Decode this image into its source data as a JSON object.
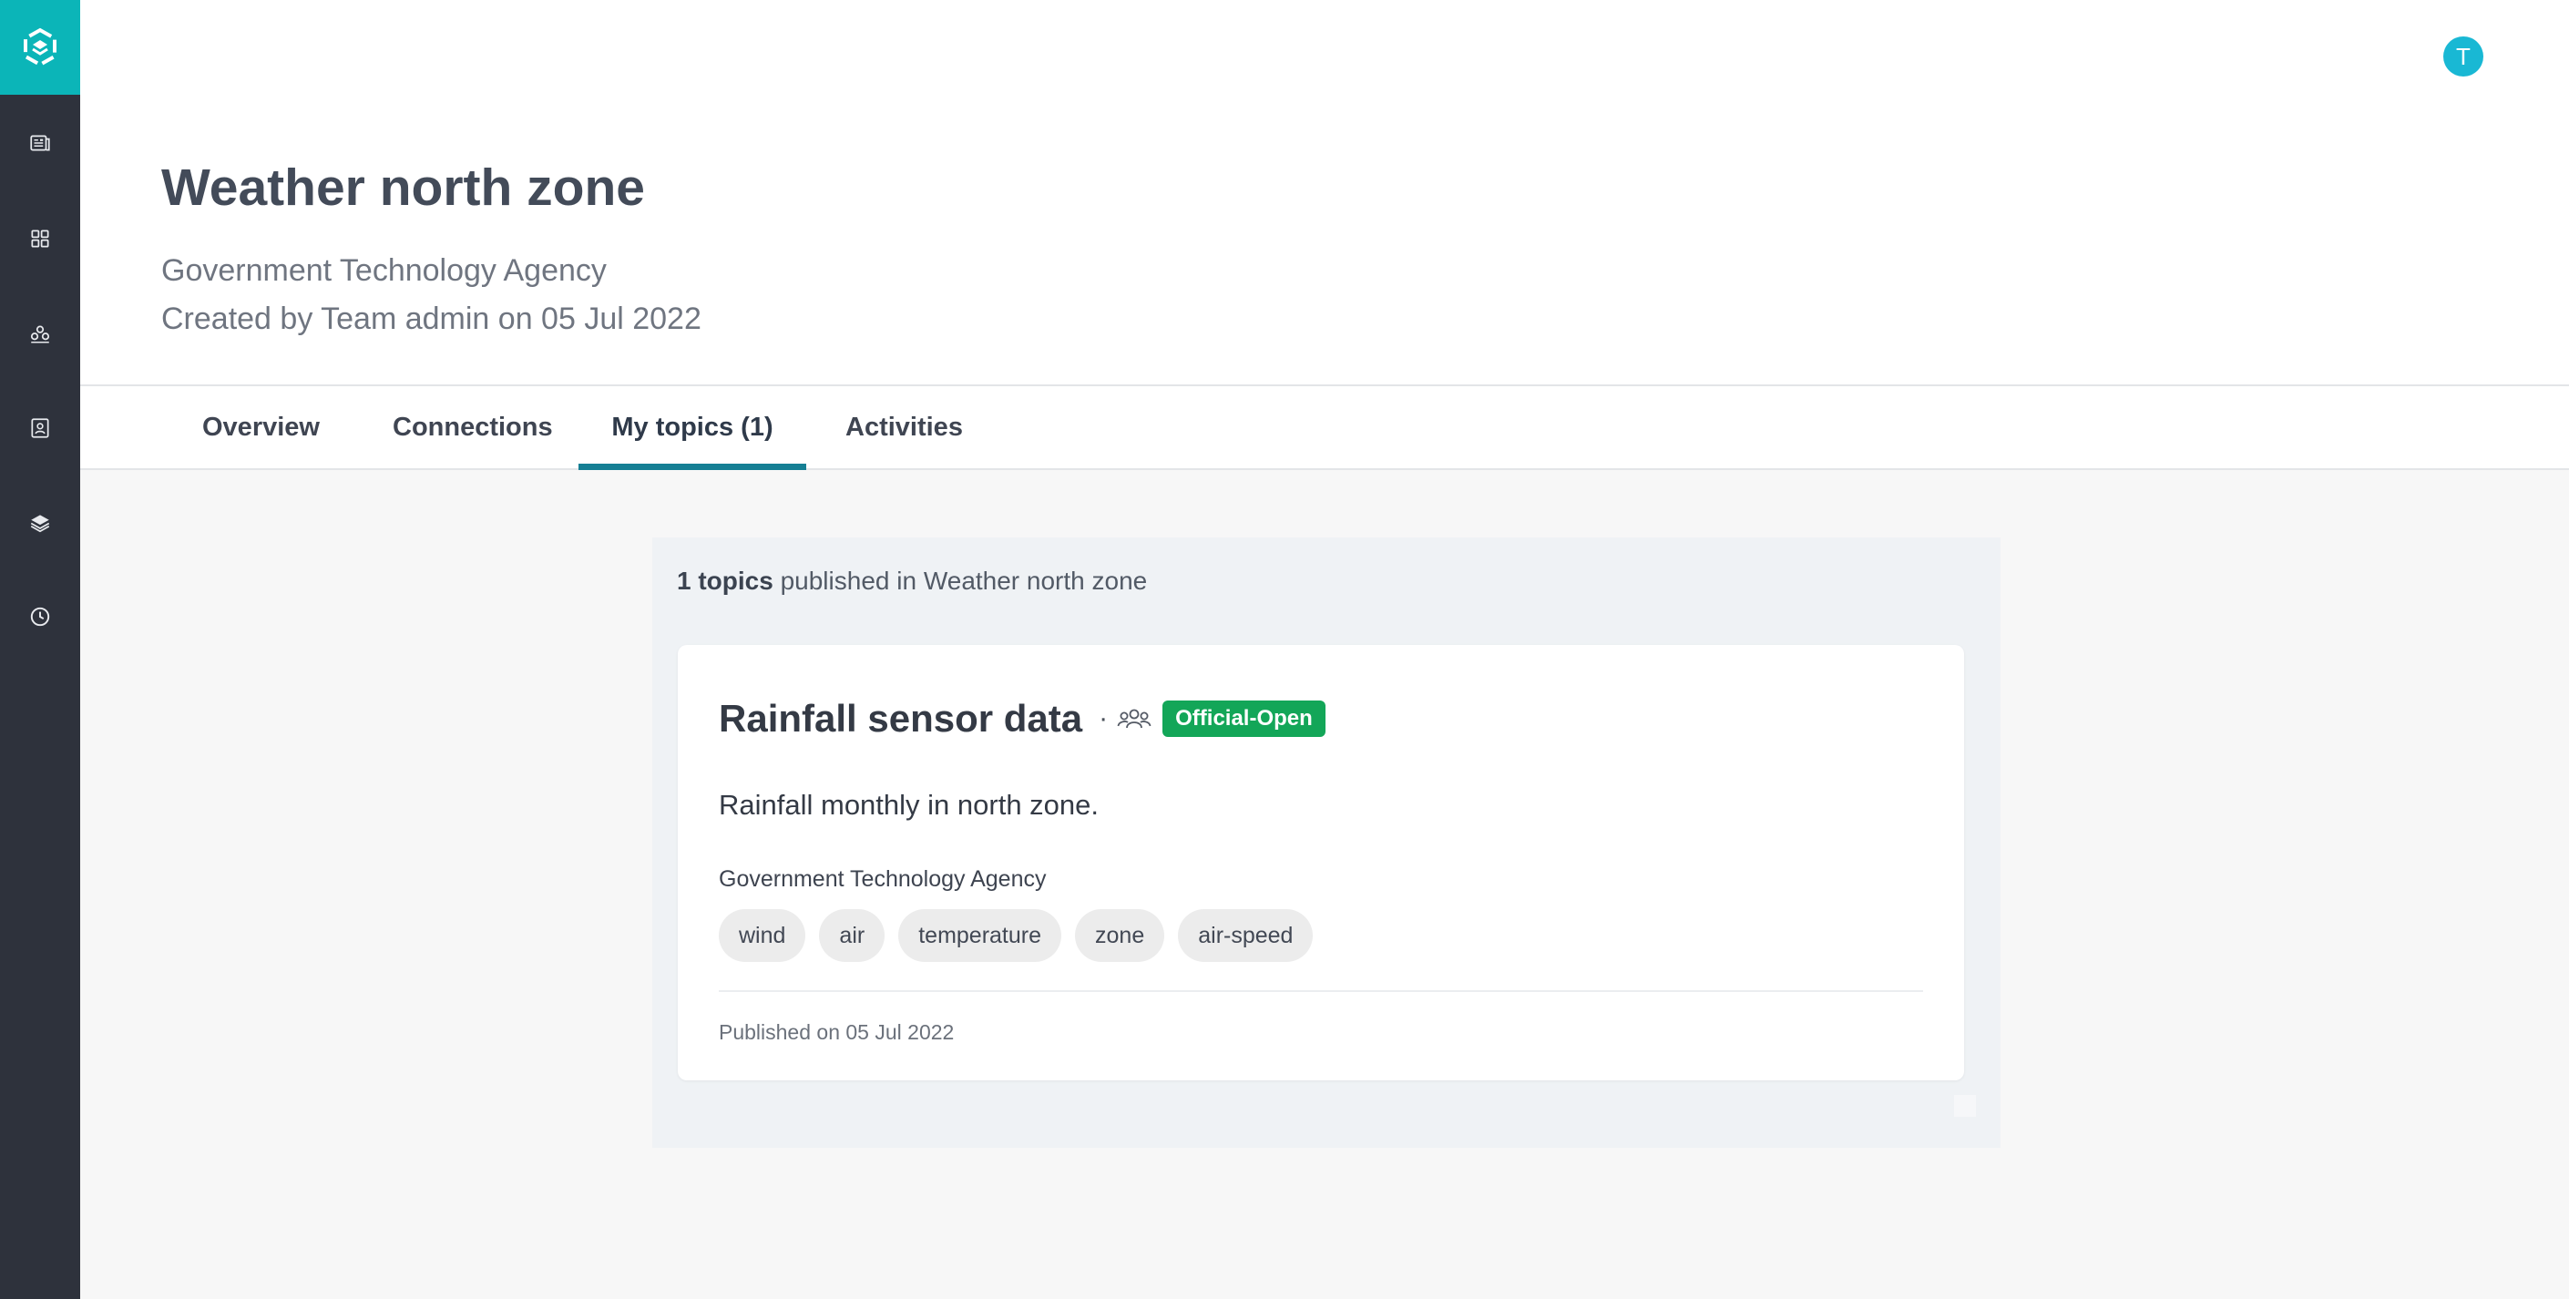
{
  "sidebar": {
    "logo": "platform-logo",
    "items": [
      {
        "name": "sidebar-item-catalog",
        "icon": "catalog-icon"
      },
      {
        "name": "sidebar-item-apps",
        "icon": "grid-icon"
      },
      {
        "name": "sidebar-item-teams",
        "icon": "teams-icon"
      },
      {
        "name": "sidebar-item-contacts",
        "icon": "contact-card-icon"
      },
      {
        "name": "sidebar-item-layers",
        "icon": "layers-icon"
      },
      {
        "name": "sidebar-item-history",
        "icon": "clock-icon"
      }
    ],
    "colors": {
      "background": "#2e323c",
      "logo_background": "#0bb5b8"
    }
  },
  "header": {
    "avatar_initial": "T",
    "avatar_color": "#19b8d4",
    "title": "Weather north zone",
    "organization": "Government Technology Agency",
    "created": "Created by Team admin on 05 Jul 2022"
  },
  "tabs": [
    {
      "label": "Overview",
      "active": false
    },
    {
      "label": "Connections",
      "active": false
    },
    {
      "label": "My topics (1)",
      "active": true
    },
    {
      "label": "Activities",
      "active": false
    }
  ],
  "topics": {
    "summary_count": "1 topics",
    "summary_rest": " published in Weather north zone",
    "items": [
      {
        "title": "Rainfall sensor data",
        "separator": "·",
        "audience_icon": "group-icon",
        "badge": "Official-Open",
        "badge_color": "#13a658",
        "description": "Rainfall monthly in north zone.",
        "organization": "Government Technology Agency",
        "tags": [
          "wind",
          "air",
          "temperature",
          "zone",
          "air-speed"
        ],
        "published": "Published on 05 Jul 2022"
      }
    ]
  },
  "accent_color": "#157f94"
}
